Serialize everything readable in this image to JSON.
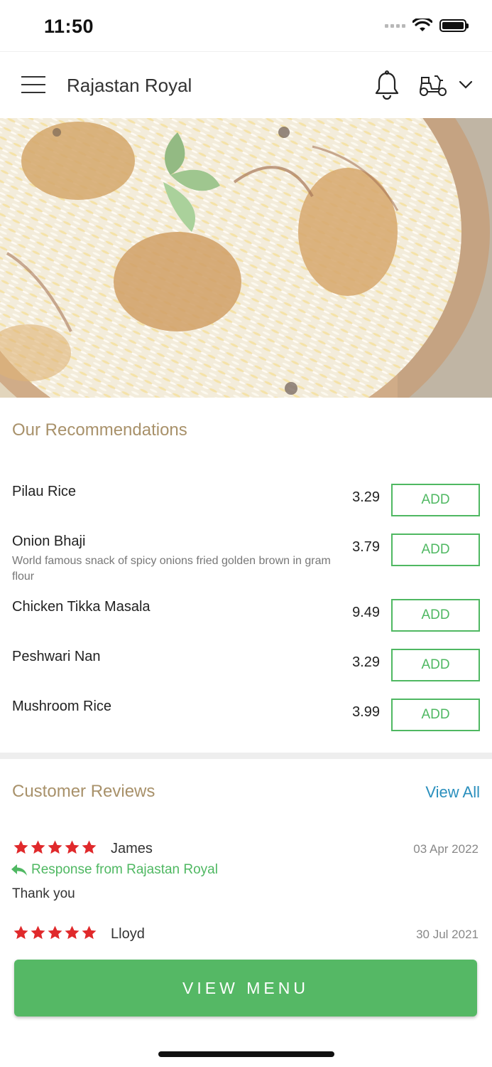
{
  "status_bar": {
    "time": "11:50"
  },
  "header": {
    "title": "Rajastan Royal"
  },
  "recommendations": {
    "title": "Our Recommendations",
    "items": [
      {
        "name": "Pilau Rice",
        "description": "",
        "price": "3.29",
        "button": "ADD"
      },
      {
        "name": "Onion Bhaji",
        "description": "World famous snack of spicy onions fried golden brown in gram flour",
        "price": "3.79",
        "button": "ADD"
      },
      {
        "name": "Chicken Tikka Masala",
        "description": "",
        "price": "9.49",
        "button": "ADD"
      },
      {
        "name": "Peshwari Nan",
        "description": "",
        "price": "3.29",
        "button": "ADD"
      },
      {
        "name": "Mushroom Rice",
        "description": "",
        "price": "3.99",
        "button": "ADD"
      }
    ]
  },
  "reviews": {
    "title": "Customer Reviews",
    "view_all": "View All",
    "items": [
      {
        "name": "James",
        "date": "03 Apr 2022",
        "rating": 5,
        "response_label": "Response from Rajastan Royal",
        "text": "Thank you"
      },
      {
        "name": "Lloyd",
        "date": "30 Jul 2021",
        "rating": 5
      }
    ]
  },
  "cta": {
    "label": "VIEW MENU"
  },
  "colors": {
    "accent": "#4fb862",
    "star": "#e0292b",
    "section_title": "#a8916a",
    "link": "#2a8fbd"
  }
}
